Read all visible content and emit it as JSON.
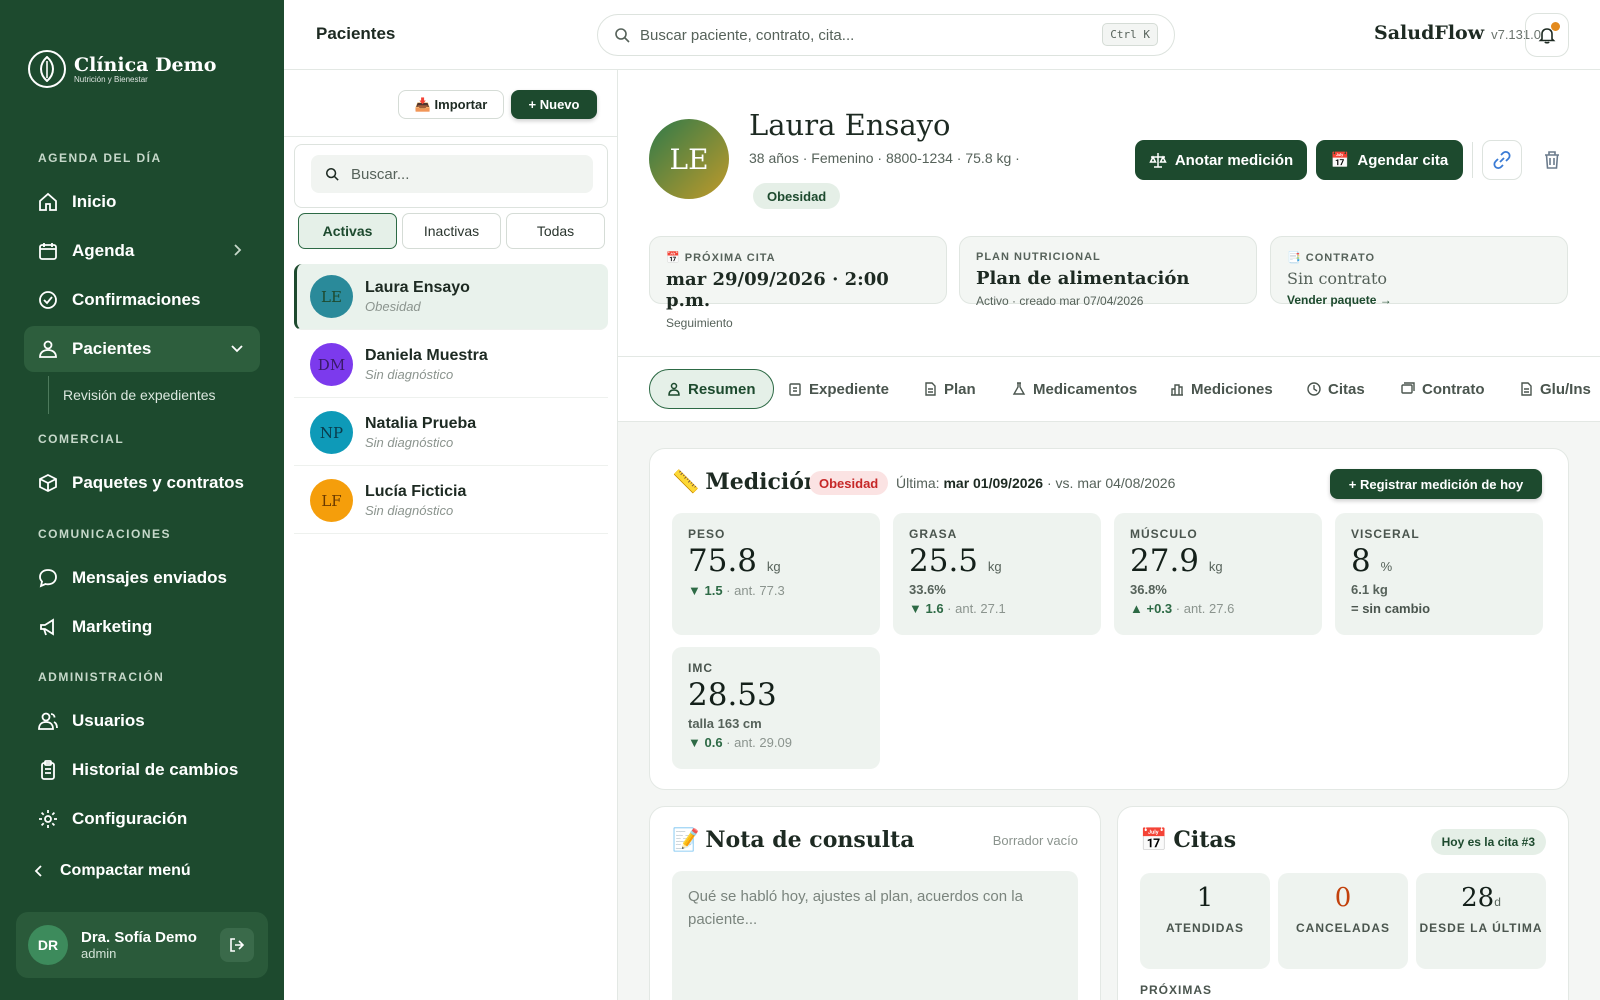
{
  "sidebar": {
    "clinic_name": "Clínica Demo",
    "clinic_sub": "Nutrición y Bienestar",
    "sections": {
      "agenda": "AGENDA DEL DÍA",
      "comercial": "COMERCIAL",
      "comunicaciones": "COMUNICACIONES",
      "admin": "ADMINISTRACIÓN"
    },
    "items": {
      "inicio": "Inicio",
      "agenda": "Agenda",
      "confirmaciones": "Confirmaciones",
      "pacientes": "Pacientes",
      "revision": "Revisión de expedientes",
      "paquetes": "Paquetes y contratos",
      "mensajes": "Mensajes enviados",
      "marketing": "Marketing",
      "usuarios": "Usuarios",
      "historial": "Historial de cambios",
      "configuracion": "Configuración"
    },
    "compact": "Compactar menú",
    "user": {
      "initials": "DR",
      "name": "Dra. Sofía Demo",
      "role": "admin"
    }
  },
  "topbar": {
    "title": "Pacientes",
    "search_placeholder": "Buscar paciente, contrato, cita...",
    "shortcut": "Ctrl K",
    "brand": "SaludFlow",
    "version": "v7.131.0"
  },
  "list": {
    "import_label": "📥 Importar",
    "new_label": "+ Nuevo",
    "search_placeholder": "Buscar...",
    "filters": [
      "Activas",
      "Inactivas",
      "Todas"
    ],
    "patients": [
      {
        "initials": "LE",
        "name": "Laura Ensayo",
        "diag": "Obesidad",
        "color": "#2a8a9a",
        "text": "#1d4a2e"
      },
      {
        "initials": "DM",
        "name": "Daniela Muestra",
        "diag": "Sin diagnóstico",
        "color": "#7c3aed",
        "text": "#3a1a6a"
      },
      {
        "initials": "NP",
        "name": "Natalia Prueba",
        "diag": "Sin diagnóstico",
        "color": "#0e9ab8",
        "text": "#0a3a4a"
      },
      {
        "initials": "LF",
        "name": "Lucía Ficticia",
        "diag": "Sin diagnóstico",
        "color": "#f59e0b",
        "text": "#6a3a00"
      }
    ]
  },
  "patient": {
    "initials": "LE",
    "name": "Laura Ensayo",
    "meta": "38 años · Femenino · 8800-1234 · 75.8 kg ·",
    "tag": "Obesidad",
    "action_measure": "Anotar medición",
    "action_appt": "Agendar cita"
  },
  "info_cards": {
    "next": {
      "label": "PRÓXIMA CITA",
      "value": "mar 29/09/2026 · 2:00 p.m.",
      "sub": "Seguimiento"
    },
    "plan": {
      "label": "PLAN NUTRICIONAL",
      "value": "Plan de alimentación",
      "sub": "Activo · creado mar 07/04/2026"
    },
    "contract": {
      "label": "CONTRATO",
      "value": "Sin contrato",
      "sub": "Vender paquete →"
    }
  },
  "tabs": [
    "Resumen",
    "Expediente",
    "Plan",
    "Medicamentos",
    "Mediciones",
    "Citas",
    "Contrato",
    "Glu/Ins"
  ],
  "measure": {
    "title": "Medición",
    "badge": "Obesidad",
    "last_prefix": "Última:",
    "last_date": "mar 01/09/2026",
    "vs": "· vs. mar 04/08/2026",
    "register": "+ Registrar medición de hoy",
    "cards": [
      {
        "label": "PESO",
        "value": "75.8",
        "unit": "kg",
        "sub": "",
        "delta": "▼ 1.5",
        "prev": " · ant. 77.3"
      },
      {
        "label": "GRASA",
        "value": "25.5",
        "unit": "kg",
        "sub": "33.6%",
        "delta": "▼ 1.6",
        "prev": " · ant. 27.1"
      },
      {
        "label": "MÚSCULO",
        "value": "27.9",
        "unit": "kg",
        "sub": "36.8%",
        "delta": "▲ +0.3",
        "prev": " · ant. 27.6"
      },
      {
        "label": "VISCERAL",
        "value": "8",
        "unit": "%",
        "sub": "6.1 kg",
        "delta": "",
        "prev": "= sin cambio"
      },
      {
        "label": "IMC",
        "value": "28.53",
        "unit": "",
        "sub": "talla 163 cm",
        "delta": "▼ 0.6",
        "prev": " · ant. 29.09"
      }
    ]
  },
  "note": {
    "title": "Nota de consulta",
    "status": "Borrador vacío",
    "placeholder": "Qué se habló hoy, ajustes al plan, acuerdos con la paciente..."
  },
  "appts": {
    "title": "Citas",
    "badge": "Hoy es la cita #3",
    "stats": [
      {
        "value": "1",
        "unit": "",
        "label": "ATENDIDAS",
        "color": "#14201a"
      },
      {
        "value": "0",
        "unit": "",
        "label": "CANCELADAS",
        "color": "#c2410c"
      },
      {
        "value": "28",
        "unit": "d",
        "label": "DESDE LA ÚLTIMA",
        "color": "#14201a"
      }
    ],
    "upcoming": "PRÓXIMAS"
  },
  "colors": {
    "brand": "#1d4a2e",
    "accent": "#2d6a45",
    "danger": "#c62828"
  }
}
